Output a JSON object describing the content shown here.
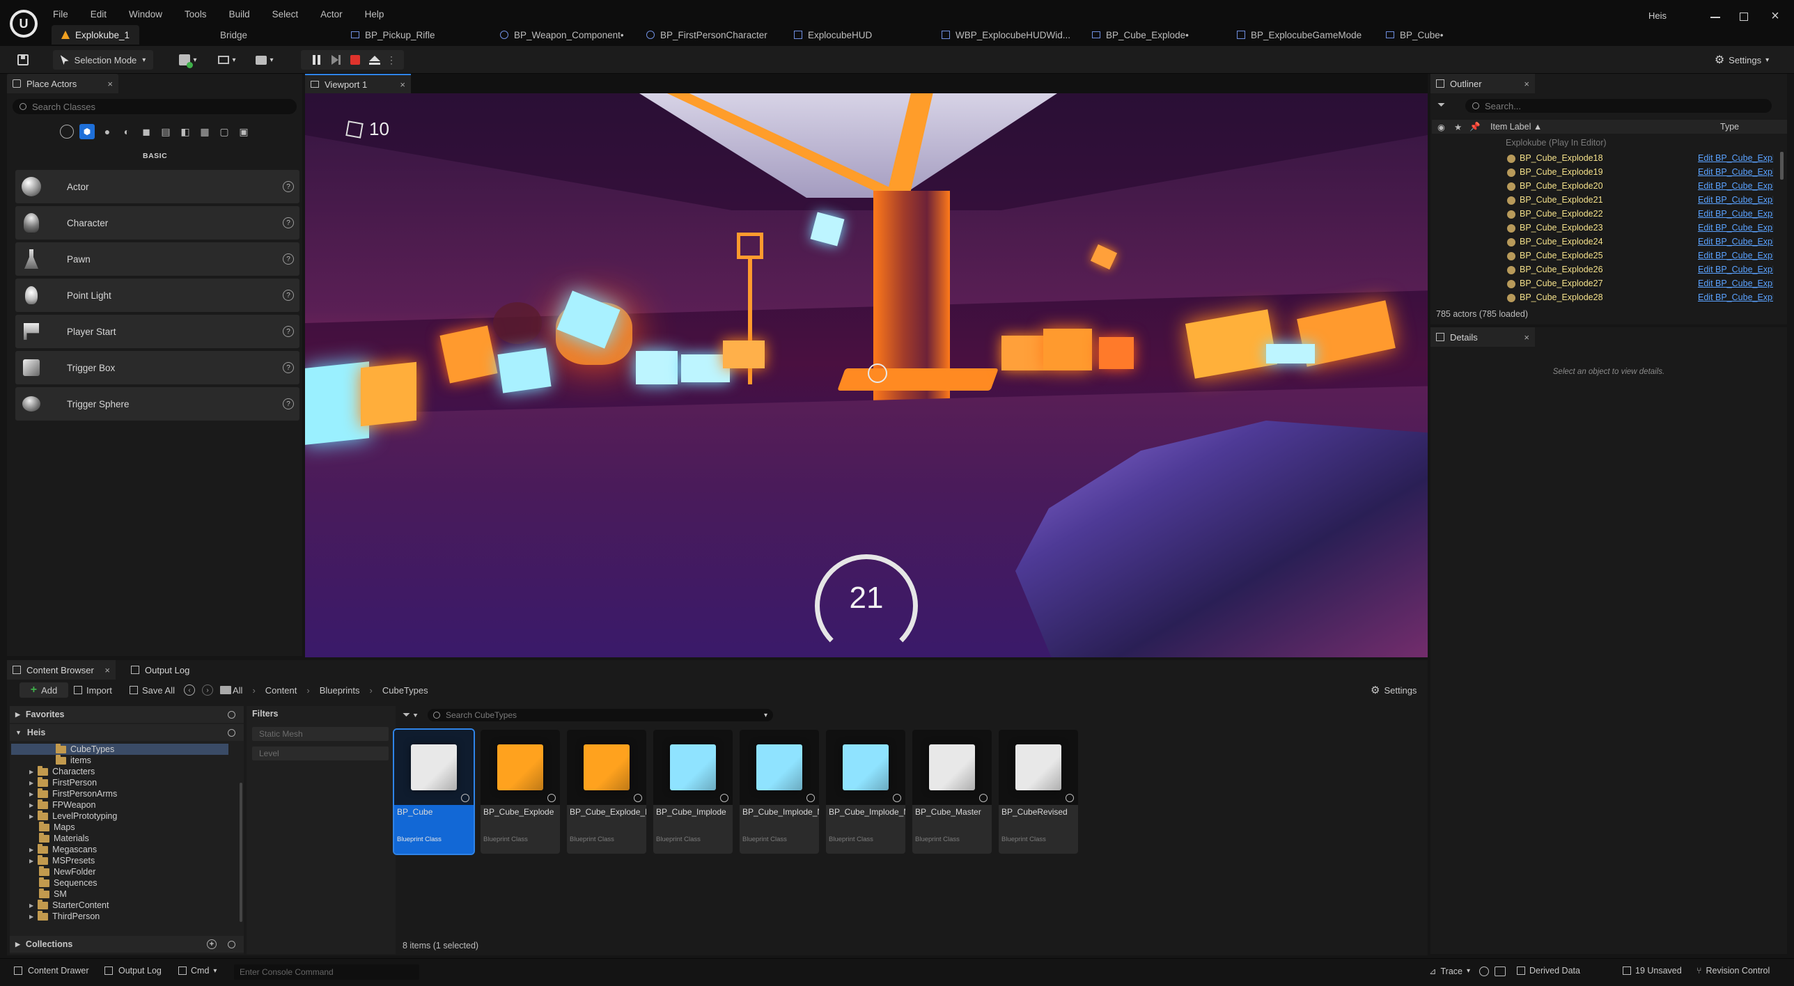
{
  "app": {
    "logo": "unreal-engine-logo",
    "user": "Heis"
  },
  "menu": [
    "File",
    "Edit",
    "Window",
    "Tools",
    "Build",
    "Select",
    "Actor",
    "Help"
  ],
  "tabs": [
    {
      "label": "Explokube_1",
      "active": true
    },
    {
      "label": "Bridge"
    },
    {
      "label": "BP_Pickup_Rifle"
    },
    {
      "label": "BP_Weapon_Component•"
    },
    {
      "label": "BP_FirstPersonCharacter"
    },
    {
      "label": "ExplocubeHUD"
    },
    {
      "label": "WBP_ExplocubeHUDWid..."
    },
    {
      "label": "BP_Cube_Explode•"
    },
    {
      "label": "BP_ExplocubeGameMode"
    },
    {
      "label": "BP_Cube•"
    }
  ],
  "toolbar": {
    "mode": "Selection Mode",
    "settings": "Settings"
  },
  "place_actors": {
    "title": "Place Actors",
    "search_placeholder": "Search Classes",
    "category": "BASIC",
    "items": [
      "Actor",
      "Character",
      "Pawn",
      "Point Light",
      "Player Start",
      "Trigger Box",
      "Trigger Sphere"
    ]
  },
  "viewport": {
    "title": "Viewport 1",
    "cube_count": "10",
    "ammo": "21"
  },
  "outliner": {
    "title": "Outliner",
    "search_placeholder": "Search...",
    "col_label": "Item Label ▲",
    "col_type": "Type",
    "root": "Explokube (Play In Editor)",
    "rows": [
      "BP_Cube_Explode18",
      "BP_Cube_Explode19",
      "BP_Cube_Explode20",
      "BP_Cube_Explode21",
      "BP_Cube_Explode22",
      "BP_Cube_Explode23",
      "BP_Cube_Explode24",
      "BP_Cube_Explode25",
      "BP_Cube_Explode26",
      "BP_Cube_Explode27",
      "BP_Cube_Explode28"
    ],
    "row_type": "Edit BP_Cube_Explo",
    "footer": "785 actors (785 loaded)"
  },
  "details": {
    "title": "Details",
    "empty": "Select an object to view details."
  },
  "content_browser": {
    "tab": "Content Browser",
    "tab2": "Output Log",
    "add": "Add",
    "import": "Import",
    "save_all": "Save All",
    "breadcrumb": [
      "All",
      "Content",
      "Blueprints",
      "CubeTypes"
    ],
    "settings": "Settings",
    "favorites": "Favorites",
    "root": "Heis",
    "tree": [
      "CubeTypes",
      "items",
      "Characters",
      "FirstPerson",
      "FirstPersonArms",
      "FPWeapon",
      "LevelPrototyping",
      "Maps",
      "Materials",
      "Megascans",
      "MSPresets",
      "NewFolder",
      "Sequences",
      "SM",
      "StarterContent",
      "ThirdPerson"
    ],
    "collections": "Collections",
    "filters_title": "Filters",
    "filters": [
      "Static Mesh",
      "Level"
    ],
    "search_placeholder": "Search CubeTypes",
    "assets": [
      {
        "name": "BP_Cube",
        "cls": "Blueprint Class",
        "color": "#e8e8e8"
      },
      {
        "name": "BP_Cube_Explode",
        "cls": "Blueprint Class",
        "color": "#ffa21e"
      },
      {
        "name": "BP_Cube_Explode_More",
        "cls": "Blueprint Class",
        "color": "#ffa21e"
      },
      {
        "name": "BP_Cube_Implode",
        "cls": "Blueprint Class",
        "color": "#8fe3ff"
      },
      {
        "name": "BP_Cube_Implode_More",
        "cls": "Blueprint Class",
        "color": "#8fe3ff"
      },
      {
        "name": "BP_Cube_Implode_More_More",
        "cls": "Blueprint Class",
        "color": "#8fe3ff"
      },
      {
        "name": "BP_Cube_Master",
        "cls": "Blueprint Class",
        "color": "#e8e8e8"
      },
      {
        "name": "BP_CubeRevised",
        "cls": "Blueprint Class",
        "color": "#e8e8e8"
      }
    ],
    "footer": "8 items (1 selected)"
  },
  "status": {
    "drawer": "Content Drawer",
    "log": "Output Log",
    "cmd": "Cmd",
    "console_placeholder": "Enter Console Command",
    "trace": "Trace",
    "derived": "Derived Data",
    "unsaved": "19 Unsaved",
    "rc": "Revision Control"
  }
}
